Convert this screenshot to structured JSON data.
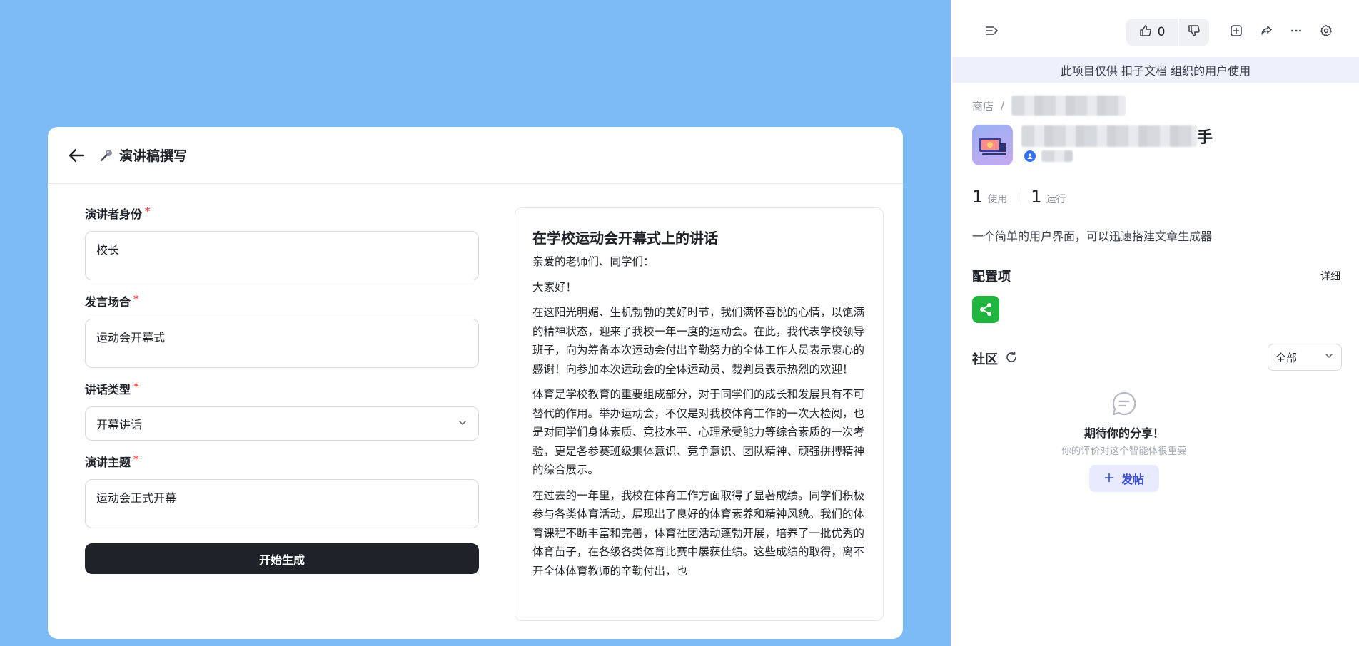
{
  "card": {
    "title": "演讲稿撰写"
  },
  "form": {
    "fields": [
      {
        "label": "演讲者身份",
        "required": "*",
        "value": "校长"
      },
      {
        "label": "发言场合",
        "required": "*",
        "value": "运动会开幕式"
      },
      {
        "label": "讲话类型",
        "required": "*",
        "value": "开幕讲话"
      },
      {
        "label": "演讲主题",
        "required": "*",
        "value": "运动会正式开幕"
      }
    ],
    "submit_label": "开始生成"
  },
  "result": {
    "title": "在学校运动会开幕式上的讲话",
    "paragraphs": [
      "亲爱的老师们、同学们：",
      "大家好！",
      "在这阳光明媚、生机勃勃的美好时节，我们满怀喜悦的心情，以饱满的精神状态，迎来了我校一年一度的运动会。在此，我代表学校领导班子，向为筹备本次运动会付出辛勤努力的全体工作人员表示衷心的感谢！向参加本次运动会的全体运动员、裁判员表示热烈的欢迎！",
      "体育是学校教育的重要组成部分，对于同学们的成长和发展具有不可替代的作用。举办运动会，不仅是对我校体育工作的一次大检阅，也是对同学们身体素质、竞技水平、心理承受能力等综合素质的一次考验，更是各参赛班级集体意识、竞争意识、团队精神、顽强拼搏精神的综合展示。",
      "在过去的一年里，我校在体育工作方面取得了显著成绩。同学们积极参与各类体育活动，展现出了良好的体育素养和精神风貌。我们的体育课程不断丰富和完善，体育社团活动蓬勃开展，培养了一批优秀的体育苗子，在各级各类体育比赛中屡获佳绩。这些成绩的取得，离不开全体体育教师的辛勤付出，也"
    ]
  },
  "panel": {
    "like_count": "0",
    "org_banner": "此项目仅供 扣子文档 组织的用户使用",
    "breadcrumb_root": "商店",
    "breadcrumb_sep": "/",
    "agent_name_suffix": "手",
    "stats": [
      {
        "value": "1",
        "label": "使用"
      },
      {
        "value": "1",
        "label": "运行"
      }
    ],
    "description": "一个简单的用户界面，可以迅速搭建文章生成器",
    "config_title": "配置项",
    "config_detail": "详细",
    "community_title": "社区",
    "filter_value": "全部",
    "empty_title": "期待你的分享！",
    "empty_subtitle": "你的评价对这个智能体很重要",
    "post_label": "发帖"
  },
  "colors": {
    "canvas": "#7dbbf7",
    "primary_button": "#1f2329",
    "required": "#f54a45",
    "plugin": "#1fb53f",
    "post_text": "#3b4cd8"
  }
}
